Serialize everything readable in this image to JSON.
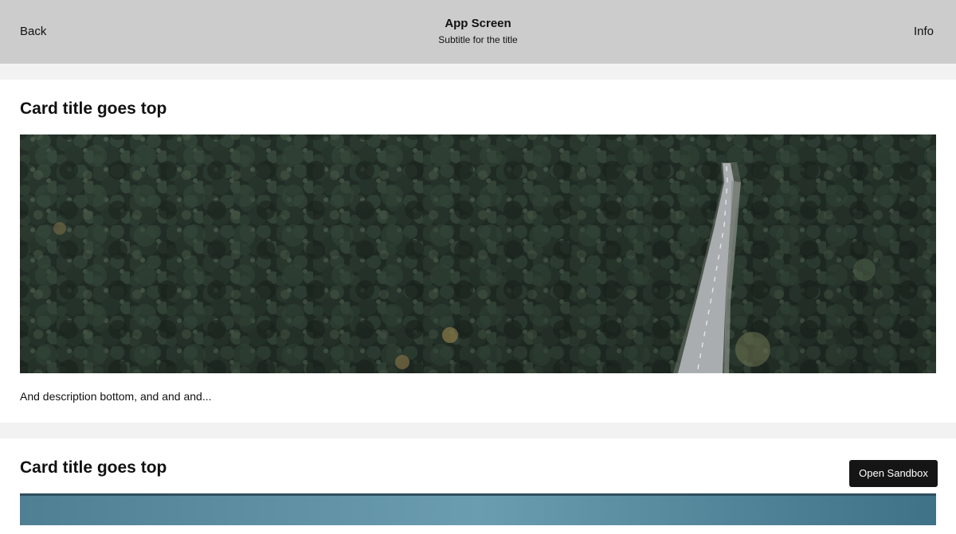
{
  "header": {
    "back_label": "Back",
    "title": "App Screen",
    "subtitle": "Subtitle for the title",
    "info_label": "Info"
  },
  "cards": [
    {
      "title": "Card title goes top",
      "description": "And description bottom, and and and..."
    },
    {
      "title": "Card title goes top"
    }
  ],
  "sandbox_button": {
    "label": "Open Sandbox"
  },
  "colors": {
    "header_bg": "#cccccc",
    "page_bg": "#f2f2f2",
    "card_bg": "#ffffff",
    "button_bg": "#151515"
  }
}
